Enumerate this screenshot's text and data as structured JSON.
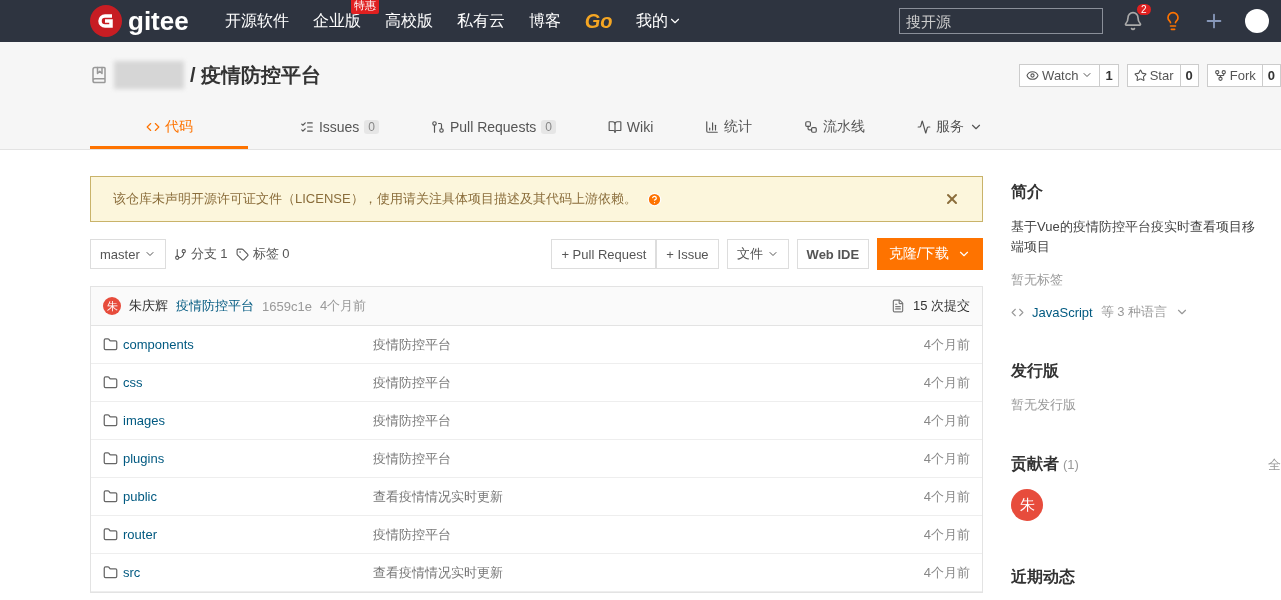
{
  "header": {
    "logo": "gitee",
    "nav": [
      {
        "label": "开源软件"
      },
      {
        "label": "企业版",
        "badge": "特惠"
      },
      {
        "label": "高校版"
      },
      {
        "label": "私有云"
      },
      {
        "label": "博客"
      }
    ],
    "go": "Go",
    "mine": "我的",
    "search": {
      "placeholder": "搜开源"
    },
    "notifications": "2"
  },
  "repo": {
    "name": "疫情防控平台",
    "separator": "/",
    "actions": [
      {
        "label": "Watch",
        "count": "1",
        "dropdown": true,
        "kind": "eye"
      },
      {
        "label": "Star",
        "count": "0",
        "dropdown": false,
        "kind": "star"
      },
      {
        "label": "Fork",
        "count": "0",
        "dropdown": false,
        "kind": "fork"
      }
    ]
  },
  "tabs": [
    {
      "label": "代码",
      "kind": "code",
      "selected": true,
      "dropdown": false
    },
    {
      "label": "Issues",
      "count": "0",
      "kind": "issues",
      "selected": false,
      "dropdown": false
    },
    {
      "label": "Pull Requests",
      "count": "0",
      "kind": "pr",
      "selected": false,
      "dropdown": false
    },
    {
      "label": "Wiki",
      "kind": "wiki",
      "selected": false,
      "dropdown": false
    },
    {
      "label": "统计",
      "kind": "stats",
      "selected": false,
      "dropdown": false
    },
    {
      "label": "流水线",
      "kind": "pipeline",
      "selected": false,
      "dropdown": false
    },
    {
      "label": "服务",
      "kind": "service",
      "selected": false,
      "dropdown": true
    }
  ],
  "notice": {
    "text": "该仓库未声明开源许可证文件（LICENSE），使用请关注具体项目描述及其代码上游依赖。"
  },
  "toolbar": {
    "branch": "master",
    "branches": "分支 1",
    "tags": "标签 0",
    "buttons": [
      "+ Pull Request",
      "+ Issue"
    ],
    "file": "文件",
    "webide": "Web IDE",
    "clone": "克隆/下载"
  },
  "commit": {
    "avatar": "朱",
    "author": "朱庆辉",
    "message": "疫情防控平台",
    "hash": "1659c1e",
    "time": "4个月前",
    "count": "15 次提交"
  },
  "files": [
    {
      "name": "components",
      "message": "疫情防控平台",
      "time": "4个月前"
    },
    {
      "name": "css",
      "message": "疫情防控平台",
      "time": "4个月前"
    },
    {
      "name": "images",
      "message": "疫情防控平台",
      "time": "4个月前"
    },
    {
      "name": "plugins",
      "message": "疫情防控平台",
      "time": "4个月前"
    },
    {
      "name": "public",
      "message": "查看疫情情况实时更新",
      "time": "4个月前"
    },
    {
      "name": "router",
      "message": "疫情防控平台",
      "time": "4个月前"
    },
    {
      "name": "src",
      "message": "查看疫情情况实时更新",
      "time": "4个月前"
    }
  ],
  "sidebar": {
    "intro_title": "简介",
    "description": [
      "基于Vue的疫情防控平台疫实时查看项目移",
      "端项目"
    ],
    "no_tags": "暂无标签",
    "language": "JavaScript",
    "language_more": "等 3 种语言",
    "releases_title": "发行版",
    "no_releases": "暂无发行版",
    "contributors_title": "贡献者",
    "contributors_count": "(1)",
    "all": "全",
    "contributors": [
      "朱"
    ],
    "activity_title": "近期动态"
  }
}
